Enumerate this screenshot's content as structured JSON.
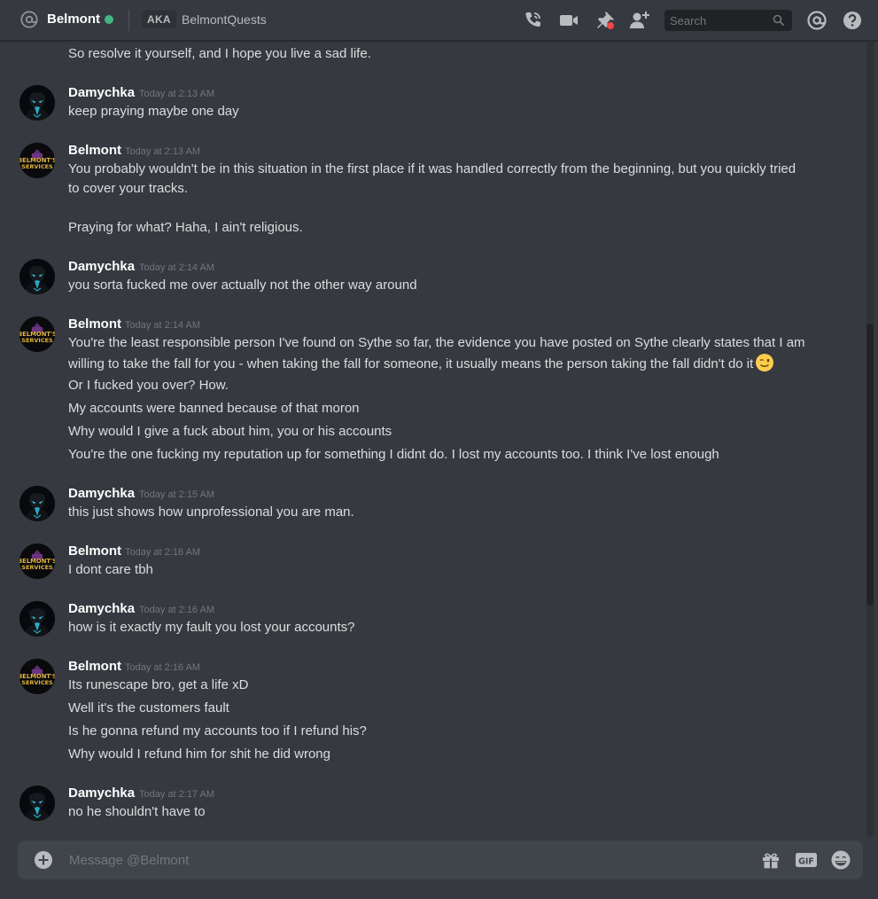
{
  "header": {
    "dm_name": "Belmont",
    "aka_label": "AKA",
    "nickname": "BelmontQuests",
    "search_placeholder": "Search",
    "icons": [
      "at-icon",
      "call-icon",
      "video-icon",
      "pin-icon",
      "add-friend-icon",
      "search-icon",
      "mentions-icon",
      "help-icon"
    ],
    "status_color": "#43b581"
  },
  "messages": {
    "partial_top": "So resolve it yourself, and I hope you live a sad life.",
    "groups": [
      {
        "author": "Damychka",
        "timestamp": "Today at 2:13 AM",
        "lines": [
          "keep praying maybe one day"
        ]
      },
      {
        "author": "Belmont",
        "timestamp": "Today at 2:13 AM",
        "lines": [
          "You probably wouldn't be in this situation in the first place if it was handled correctly from the beginning, but you quickly tried to cover your tracks.",
          "Praying for what? Haha, I ain't religious."
        ]
      },
      {
        "author": "Damychka",
        "timestamp": "Today at 2:14 AM",
        "lines": [
          "you sorta fucked me over actually not the other way around"
        ]
      },
      {
        "author": "Belmont",
        "timestamp": "Today at 2:14 AM",
        "lines": [
          "You're the least responsible person I've found on Sythe so far, the evidence you have posted on Sythe clearly states that I am willing to take the fall for you - when taking the fall for someone, it usually means the person taking the fall didn't do it",
          "Or I fucked you over? How.",
          "My accounts were banned because of that moron",
          "Why would I give a fuck about him, you or his accounts",
          "You're the one fucking my reputation up for something I didnt do. I lost my accounts too. I think I've lost enough"
        ]
      },
      {
        "author": "Damychka",
        "timestamp": "Today at 2:15 AM",
        "lines": [
          "this just shows how unprofessional you are man."
        ]
      },
      {
        "author": "Belmont",
        "timestamp": "Today at 2:16 AM",
        "lines": [
          "I dont care tbh"
        ]
      },
      {
        "author": "Damychka",
        "timestamp": "Today at 2:16 AM",
        "lines": [
          "how is it exactly my fault you lost your accounts?"
        ]
      },
      {
        "author": "Belmont",
        "timestamp": "Today at 2:16 AM",
        "lines": [
          "Its runescape bro, get a life xD",
          "Well it's the customers fault",
          "Is he gonna refund my accounts too if I refund his?",
          "Why would I refund him for shit he did wrong"
        ]
      },
      {
        "author": "Damychka",
        "timestamp": "Today at 2:17 AM",
        "lines": [
          "no he shouldn't have to"
        ]
      }
    ],
    "avatar_text_belmont": [
      "BELMONT'S",
      "SERVICES"
    ],
    "emoji": "wink-emoji"
  },
  "composer": {
    "placeholder": "Message @Belmont",
    "gif_label": "GIF",
    "icons": [
      "add-icon",
      "gift-icon",
      "gif-icon",
      "emoji-picker-icon"
    ]
  }
}
